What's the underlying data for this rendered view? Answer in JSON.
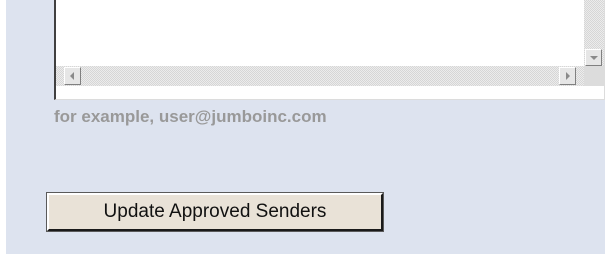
{
  "approved_senders": {
    "textbox_value": "",
    "example_hint": "for example, user@jumboinc.com",
    "update_button_label": "Update Approved Senders"
  },
  "colors": {
    "panel_background": "#dde3ef",
    "hint_text": "#999999",
    "button_face": "#e9e2d7"
  },
  "icons": {
    "scroll_left": "scroll-left-arrow-icon",
    "scroll_right": "scroll-right-arrow-icon",
    "scroll_down": "scroll-down-arrow-icon"
  }
}
